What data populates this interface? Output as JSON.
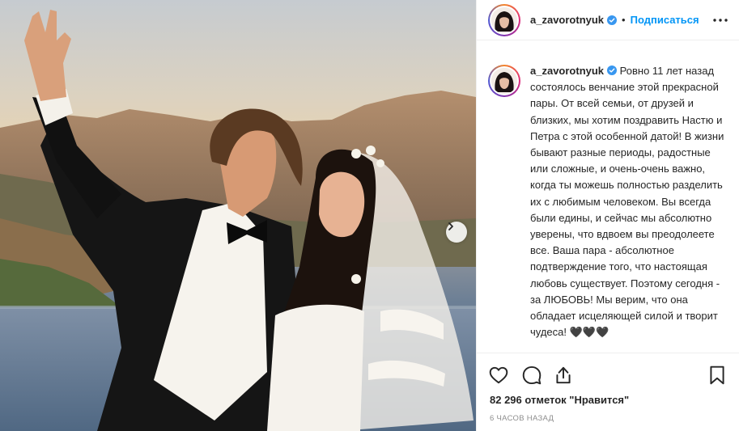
{
  "post": {
    "image_alt": "wedding photo of a couple by the sea",
    "next_icon": "chevron-right-icon"
  },
  "header": {
    "username": "a_zavorotnyuk",
    "separator": "•",
    "follow_label": "Подписаться",
    "more_icon": "more-horizontal-icon"
  },
  "caption": {
    "username": "a_zavorotnyuk",
    "text": "Ровно 11 лет назад состоялось венчание этой прекрасной пары. От всей семьи, от друзей и близких, мы хотим поздравить Настю и Петра с этой особенной датой! В жизни бывают разные периоды, радостные или сложные, и очень-очень важно, когда ты можешь полностью разделить их с любимым человеком. Вы всегда были едины, и сейчас мы абсолютно уверены, что вдвоем вы преодолеете все. Ваша пара - абсолютное подтверждение того, что настоящая любовь существует. Поэтому сегодня - за ЛЮБОВЬ! Мы верим, что она обладает исцеляющей силой и творит чудеса! 🖤🖤🖤"
  },
  "actions": {
    "like_icon": "heart-icon",
    "comment_icon": "comment-icon",
    "share_icon": "share-icon",
    "save_icon": "bookmark-icon",
    "likes_text": "82 296 отметок \"Нравится\"",
    "timestamp": "6 ЧАСОВ НАЗАД"
  },
  "colors": {
    "link": "#0095f6",
    "verified": "#3897f0",
    "muted": "#8e8e8e"
  }
}
